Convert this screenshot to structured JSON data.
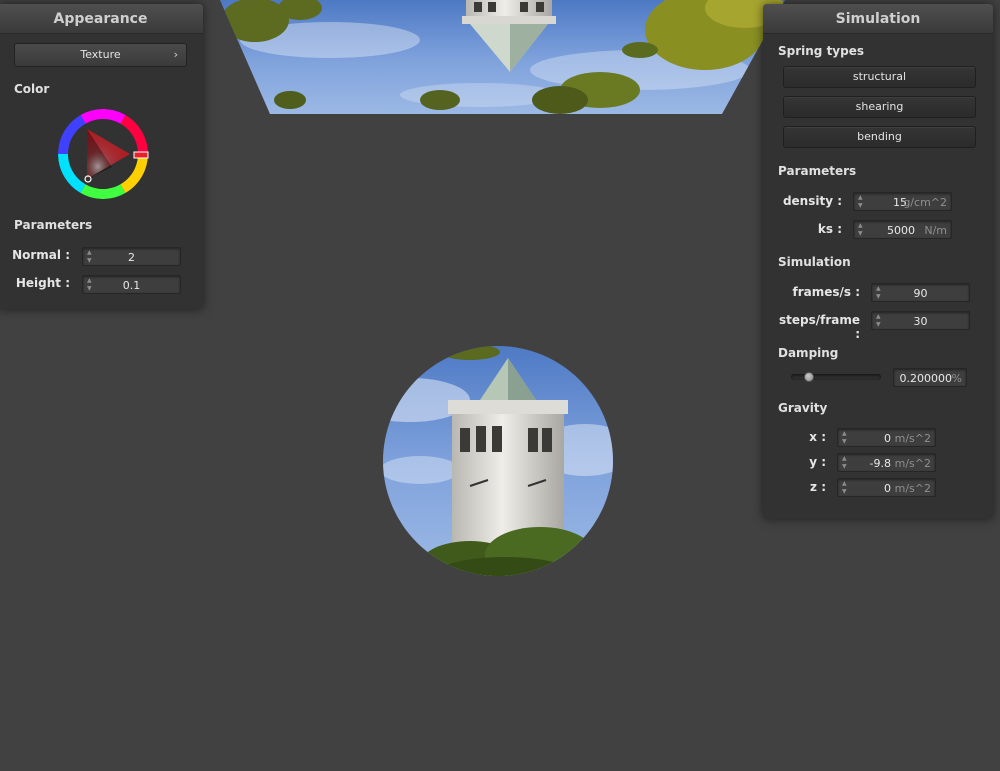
{
  "appearance": {
    "title": "Appearance",
    "texture_button": "Texture",
    "color_label": "Color",
    "parameters_label": "Parameters",
    "normal_label": "Normal :",
    "normal_value": "2",
    "height_label": "Height :",
    "height_value": "0.1",
    "selected_color": "#e8202a"
  },
  "simulation": {
    "title": "Simulation",
    "spring_types_label": "Spring types",
    "spring_buttons": [
      "structural",
      "shearing",
      "bending"
    ],
    "parameters_label": "Parameters",
    "density_label": "density :",
    "density_value": "15",
    "density_unit": "g/cm^2",
    "ks_label": "ks :",
    "ks_value": "5000",
    "ks_unit": "N/m",
    "simulation_label": "Simulation",
    "fps_label": "frames/s :",
    "fps_value": "90",
    "steps_label": "steps/frame :",
    "steps_value": "30",
    "damping_label": "Damping",
    "damping_value": "0.200000",
    "damping_unit": "%",
    "gravity_label": "Gravity",
    "gx_label": "x :",
    "gx_value": "0",
    "gy_label": "y :",
    "gy_value": "-9.8",
    "gz_label": "z :",
    "gz_value": "0",
    "gravity_unit": "m/s^2"
  }
}
